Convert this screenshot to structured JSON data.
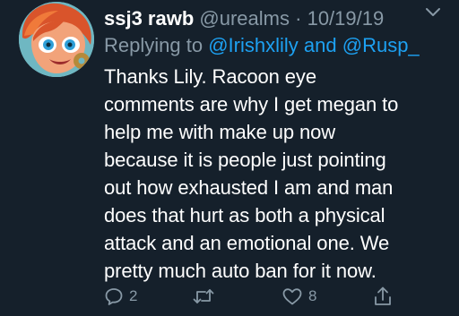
{
  "tweet": {
    "display_name": "ssj3 rawb",
    "handle": "@urealms",
    "separator": "·",
    "date": "10/19/19",
    "replying_prefix": "Replying to",
    "mention_1": "@Irishxlily",
    "mention_joiner": "and",
    "mention_2": "@Rusp_",
    "text_lines": [
      "Thanks Lily. Racoon eye",
      "comments are why I get megan to",
      "help me with make up now",
      "because it is people just pointing",
      "out how exhausted I am and man",
      "does that hurt as both a physical",
      "attack and an emotional one. We",
      "pretty much auto ban for it now."
    ],
    "reply_count": "2",
    "like_count": "8"
  },
  "icons": {
    "more": "chevron-down-icon",
    "reply": "reply-icon",
    "retweet": "retweet-icon",
    "like": "heart-icon",
    "share": "share-icon"
  },
  "colors": {
    "background": "#15202b",
    "text": "#ffffff",
    "secondary": "#8899a6",
    "link": "#1da1f2"
  }
}
